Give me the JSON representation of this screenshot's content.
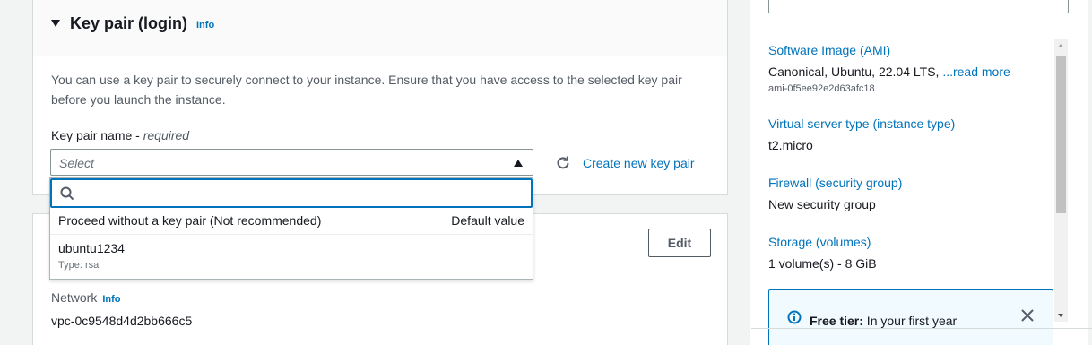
{
  "key_pair_section": {
    "title": "Key pair (login)",
    "info": "Info",
    "description": "You can use a key pair to securely connect to your instance. Ensure that you have access to the selected key pair before you launch the instance.",
    "field_label": "Key pair name - ",
    "field_required": "required",
    "select_placeholder": "Select",
    "create_link": "Create new key pair"
  },
  "dropdown": {
    "search_value": "",
    "options": [
      {
        "label": "Proceed without a key pair (Not recommended)",
        "tag": "Default value"
      },
      {
        "label": "ubuntu1234",
        "sublabel": "Type: rsa"
      }
    ]
  },
  "network_section": {
    "edit_label": "Edit",
    "network_label": "Network",
    "network_info": "Info",
    "vpc": "vpc-0c9548d4d2bb666c5"
  },
  "summary": {
    "ami_link": "Software Image (AMI)",
    "ami_value": "Canonical, Ubuntu, 22.04 LTS, ",
    "ami_read_more": "...read more",
    "ami_id": "ami-0f5ee92e2d63afc18",
    "instance_type_link": "Virtual server type (instance type)",
    "instance_type_value": "t2.micro",
    "firewall_link": "Firewall (security group)",
    "firewall_value": "New security group",
    "storage_link": "Storage (volumes)",
    "storage_value": "1 volume(s) - 8 GiB",
    "free_tier_bold": "Free tier:",
    "free_tier_text": " In your first year"
  },
  "colors": {
    "link": "#0073bb",
    "text": "#16191f",
    "secondary_text": "#545b64",
    "border": "#d5dbdb",
    "page_bg": "#f2f3f3"
  }
}
